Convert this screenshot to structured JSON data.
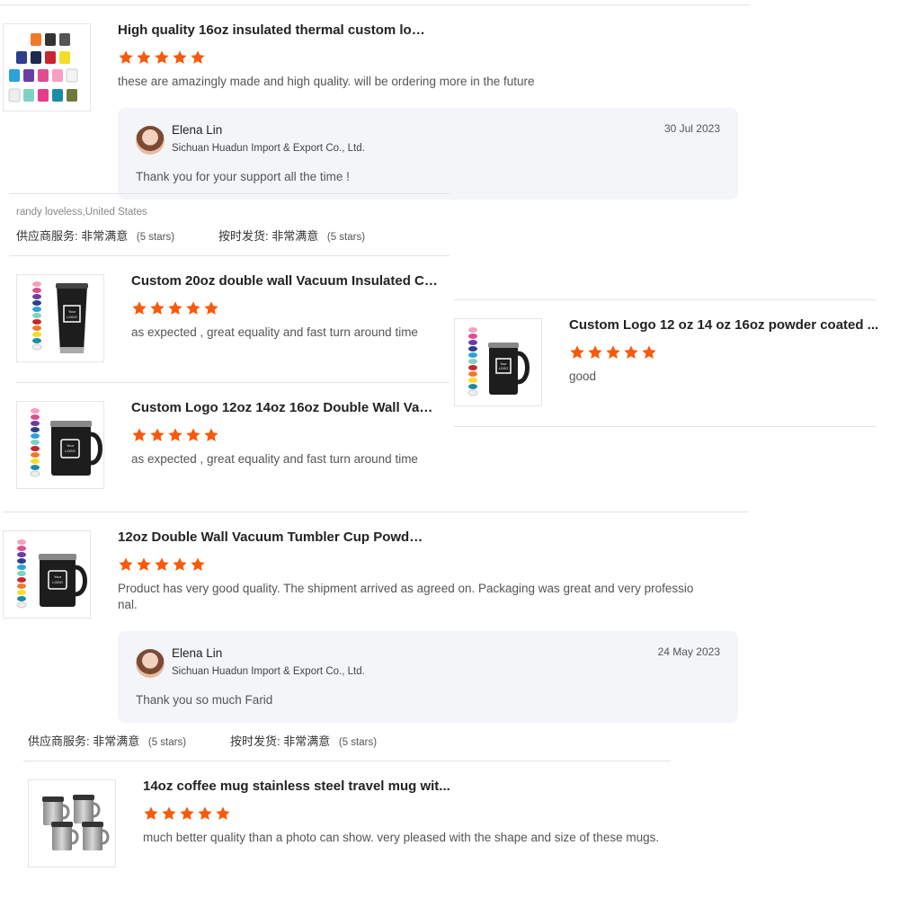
{
  "colors": {
    "star": "#f85a0a",
    "reply_bg": "#f4f5f9"
  },
  "reviews": [
    {
      "title": "High quality 16oz insulated thermal custom log...",
      "rating": 5,
      "comment": "these are amazingly made and high quality. will be ordering more in the future",
      "thumb_icon": "colorful-mugs-grid",
      "reply": {
        "name": "Elena Lin",
        "company": "Sichuan Huadun Import & Export Co., Ltd.",
        "date": "30 Jul 2023",
        "text": "Thank you for your support all the time !"
      }
    },
    {
      "title": "Custom 20oz double wall Vacuum Insulated Ca...",
      "rating": 5,
      "comment": "as expected , great equality and fast turn around time",
      "thumb_icon": "black-tumbler-logo"
    },
    {
      "title": "Custom Logo 12 oz 14 oz 16oz powder coated ...",
      "rating": 5,
      "comment": "good",
      "thumb_icon": "black-mug-logo"
    },
    {
      "title": "Custom Logo 12oz 14oz 16oz Double Wall Vac...",
      "rating": 5,
      "comment": "as expected , great equality and fast turn around time",
      "thumb_icon": "black-mug-logo"
    },
    {
      "title": "12oz Double Wall Vacuum Tumbler Cup Powde...",
      "rating": 5,
      "comment_line1": "Product has very good quality. The shipment arrived as agreed on. Packaging was great and very professio",
      "comment_line2": "nal.",
      "thumb_icon": "black-mug-logo",
      "reply": {
        "name": "Elena Lin",
        "company": "Sichuan Huadun Import & Export Co., Ltd.",
        "date": "24 May 2023",
        "text": "Thank you so much Farid"
      }
    },
    {
      "title": "14oz coffee mug stainless steel travel mug wit...",
      "rating": 5,
      "comment": "much better quality than a photo can show. very pleased with the shape and size of these mugs.",
      "thumb_icon": "steel-mugs"
    }
  ],
  "buyer_line": "randy loveless,United States",
  "ratings_row": {
    "supplier_label": "供应商服务:",
    "supplier_value": "非常满意",
    "supplier_stars": "(5 stars)",
    "ontime_label": "按时发货:",
    "ontime_value": "非常满意",
    "ontime_stars": "(5 stars)"
  },
  "logo_text": {
    "line1": "Your",
    "line2": "LOGO"
  }
}
